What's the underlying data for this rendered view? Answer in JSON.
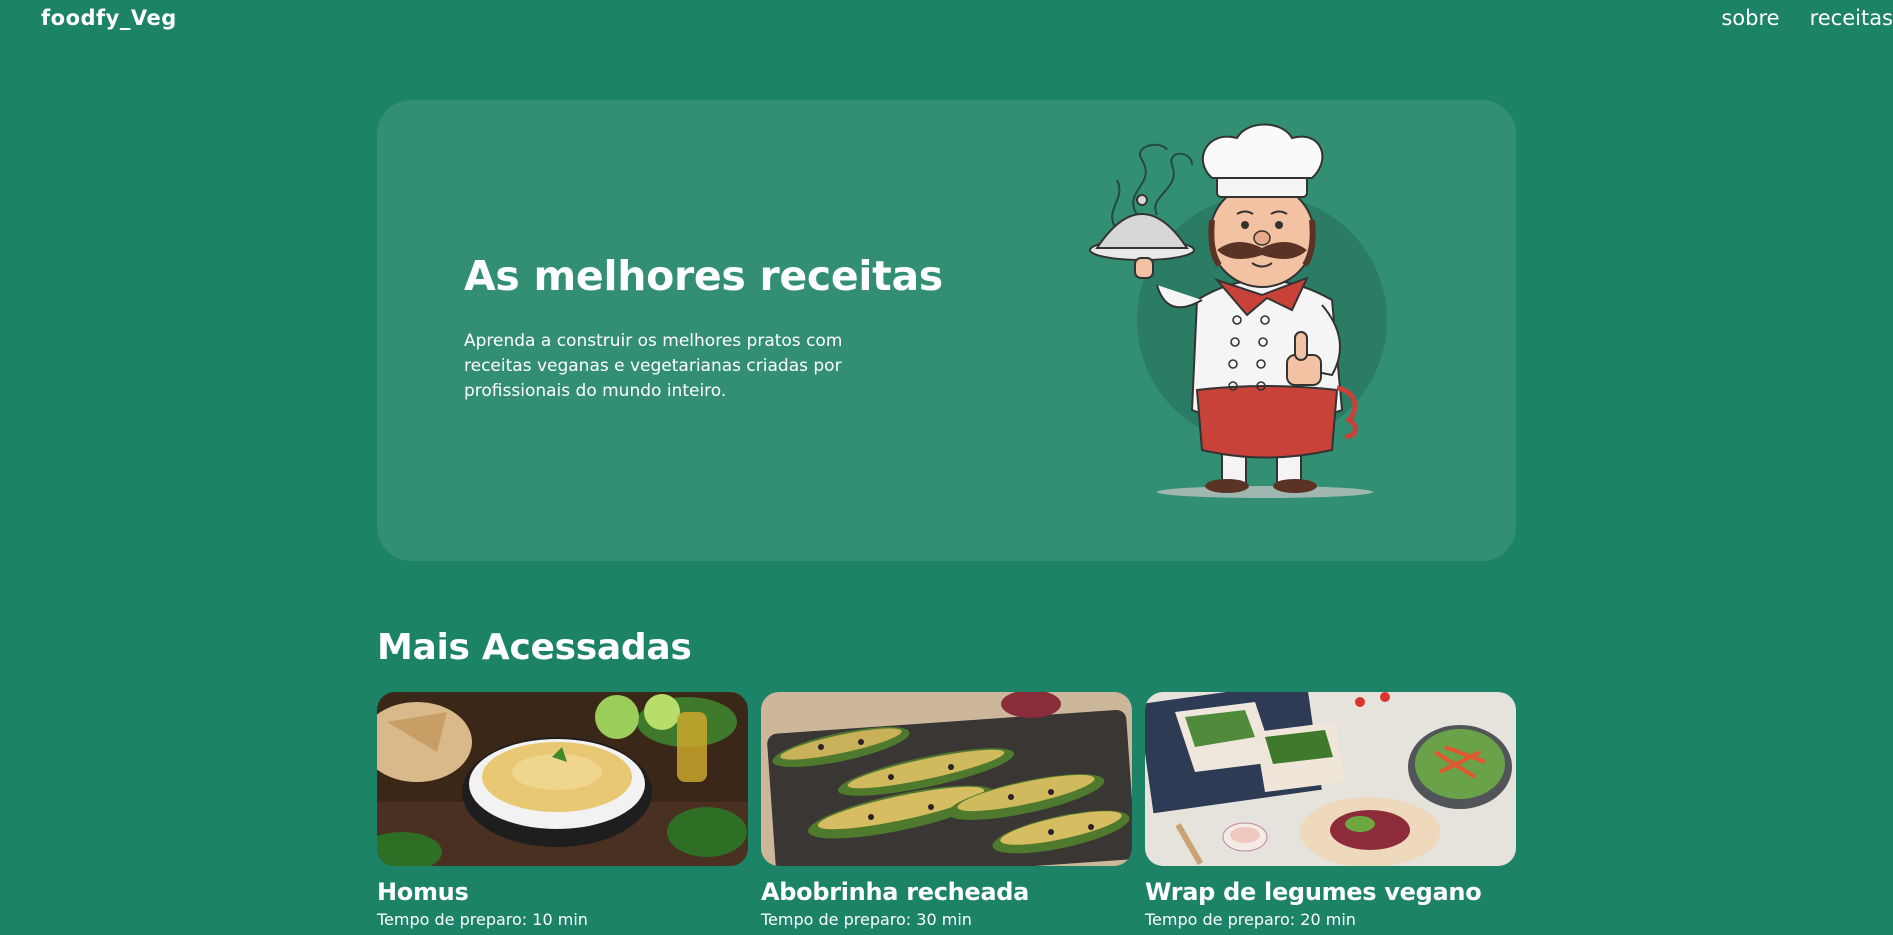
{
  "header": {
    "logo": "foodfy_Veg",
    "nav": [
      {
        "label": "sobre"
      },
      {
        "label": "receitas"
      }
    ]
  },
  "hero": {
    "title": "As melhores receitas",
    "description": "Aprenda a construir os melhores pratos com receitas veganas e vegetarianas criadas por profissionais do mundo inteiro.",
    "illustration": "chef-illustration"
  },
  "most_accessed": {
    "title": "Mais Acessadas",
    "recipes": [
      {
        "name": "Homus",
        "time": "Tempo de preparo: 10 min",
        "image": "homus-photo"
      },
      {
        "name": "Abobrinha recheada",
        "time": "Tempo de preparo: 30 min",
        "image": "zucchini-photo"
      },
      {
        "name": "Wrap de legumes vegano",
        "time": "Tempo de preparo: 20 min",
        "image": "wrap-photo"
      }
    ]
  },
  "colors": {
    "background": "#1c8366",
    "hero_card": "#338f73",
    "text": "#ffffff"
  }
}
